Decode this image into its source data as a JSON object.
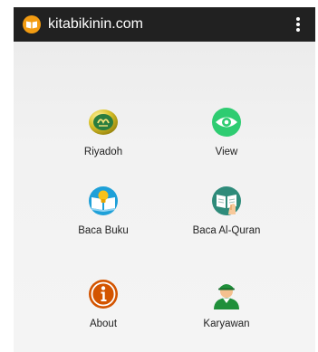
{
  "app": {
    "title": "kitabikinin.com",
    "accent_color": "#f39c12",
    "bar_color": "#212121"
  },
  "appbar": {
    "logo_icon": "open-book-icon",
    "overflow_icon": "more-vert-icon"
  },
  "menu": {
    "items": [
      {
        "label": "Riyadoh",
        "icon": "quran-disc-icon",
        "color": "#c7b31a"
      },
      {
        "label": "View",
        "icon": "eye-icon",
        "color": "#2ecc71"
      },
      {
        "label": "Baca Buku",
        "icon": "open-book-lightbulb-icon",
        "color": "#1ea0d8"
      },
      {
        "label": "Baca Al-Quran",
        "icon": "quran-reader-icon",
        "color": "#2e8b7a"
      },
      {
        "label": "About",
        "icon": "info-icon",
        "color": "#d35400"
      },
      {
        "label": "Karyawan",
        "icon": "employee-icon",
        "color": "#1f8f3a"
      }
    ]
  }
}
